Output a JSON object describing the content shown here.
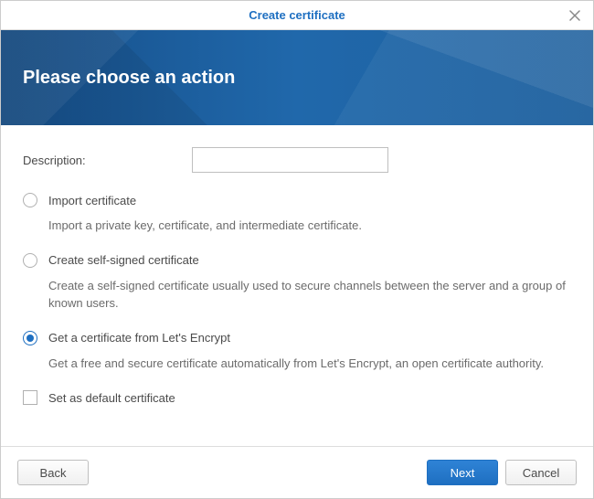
{
  "titlebar": {
    "title": "Create certificate"
  },
  "banner": {
    "heading": "Please choose an action"
  },
  "form": {
    "description_label": "Description:",
    "description_value": "",
    "options": {
      "import": {
        "label": "Import certificate",
        "desc": "Import a private key, certificate, and intermediate certificate.",
        "selected": false
      },
      "selfsigned": {
        "label": "Create self-signed certificate",
        "desc": "Create a self-signed certificate usually used to secure channels between the server and a group of known users.",
        "selected": false
      },
      "letsencrypt": {
        "label": "Get a certificate from Let's Encrypt",
        "desc": "Get a free and secure certificate automatically from Let's Encrypt, an open certificate authority.",
        "selected": true
      }
    },
    "set_default_label": "Set as default certificate",
    "set_default_checked": false
  },
  "buttons": {
    "back": "Back",
    "next": "Next",
    "cancel": "Cancel"
  }
}
